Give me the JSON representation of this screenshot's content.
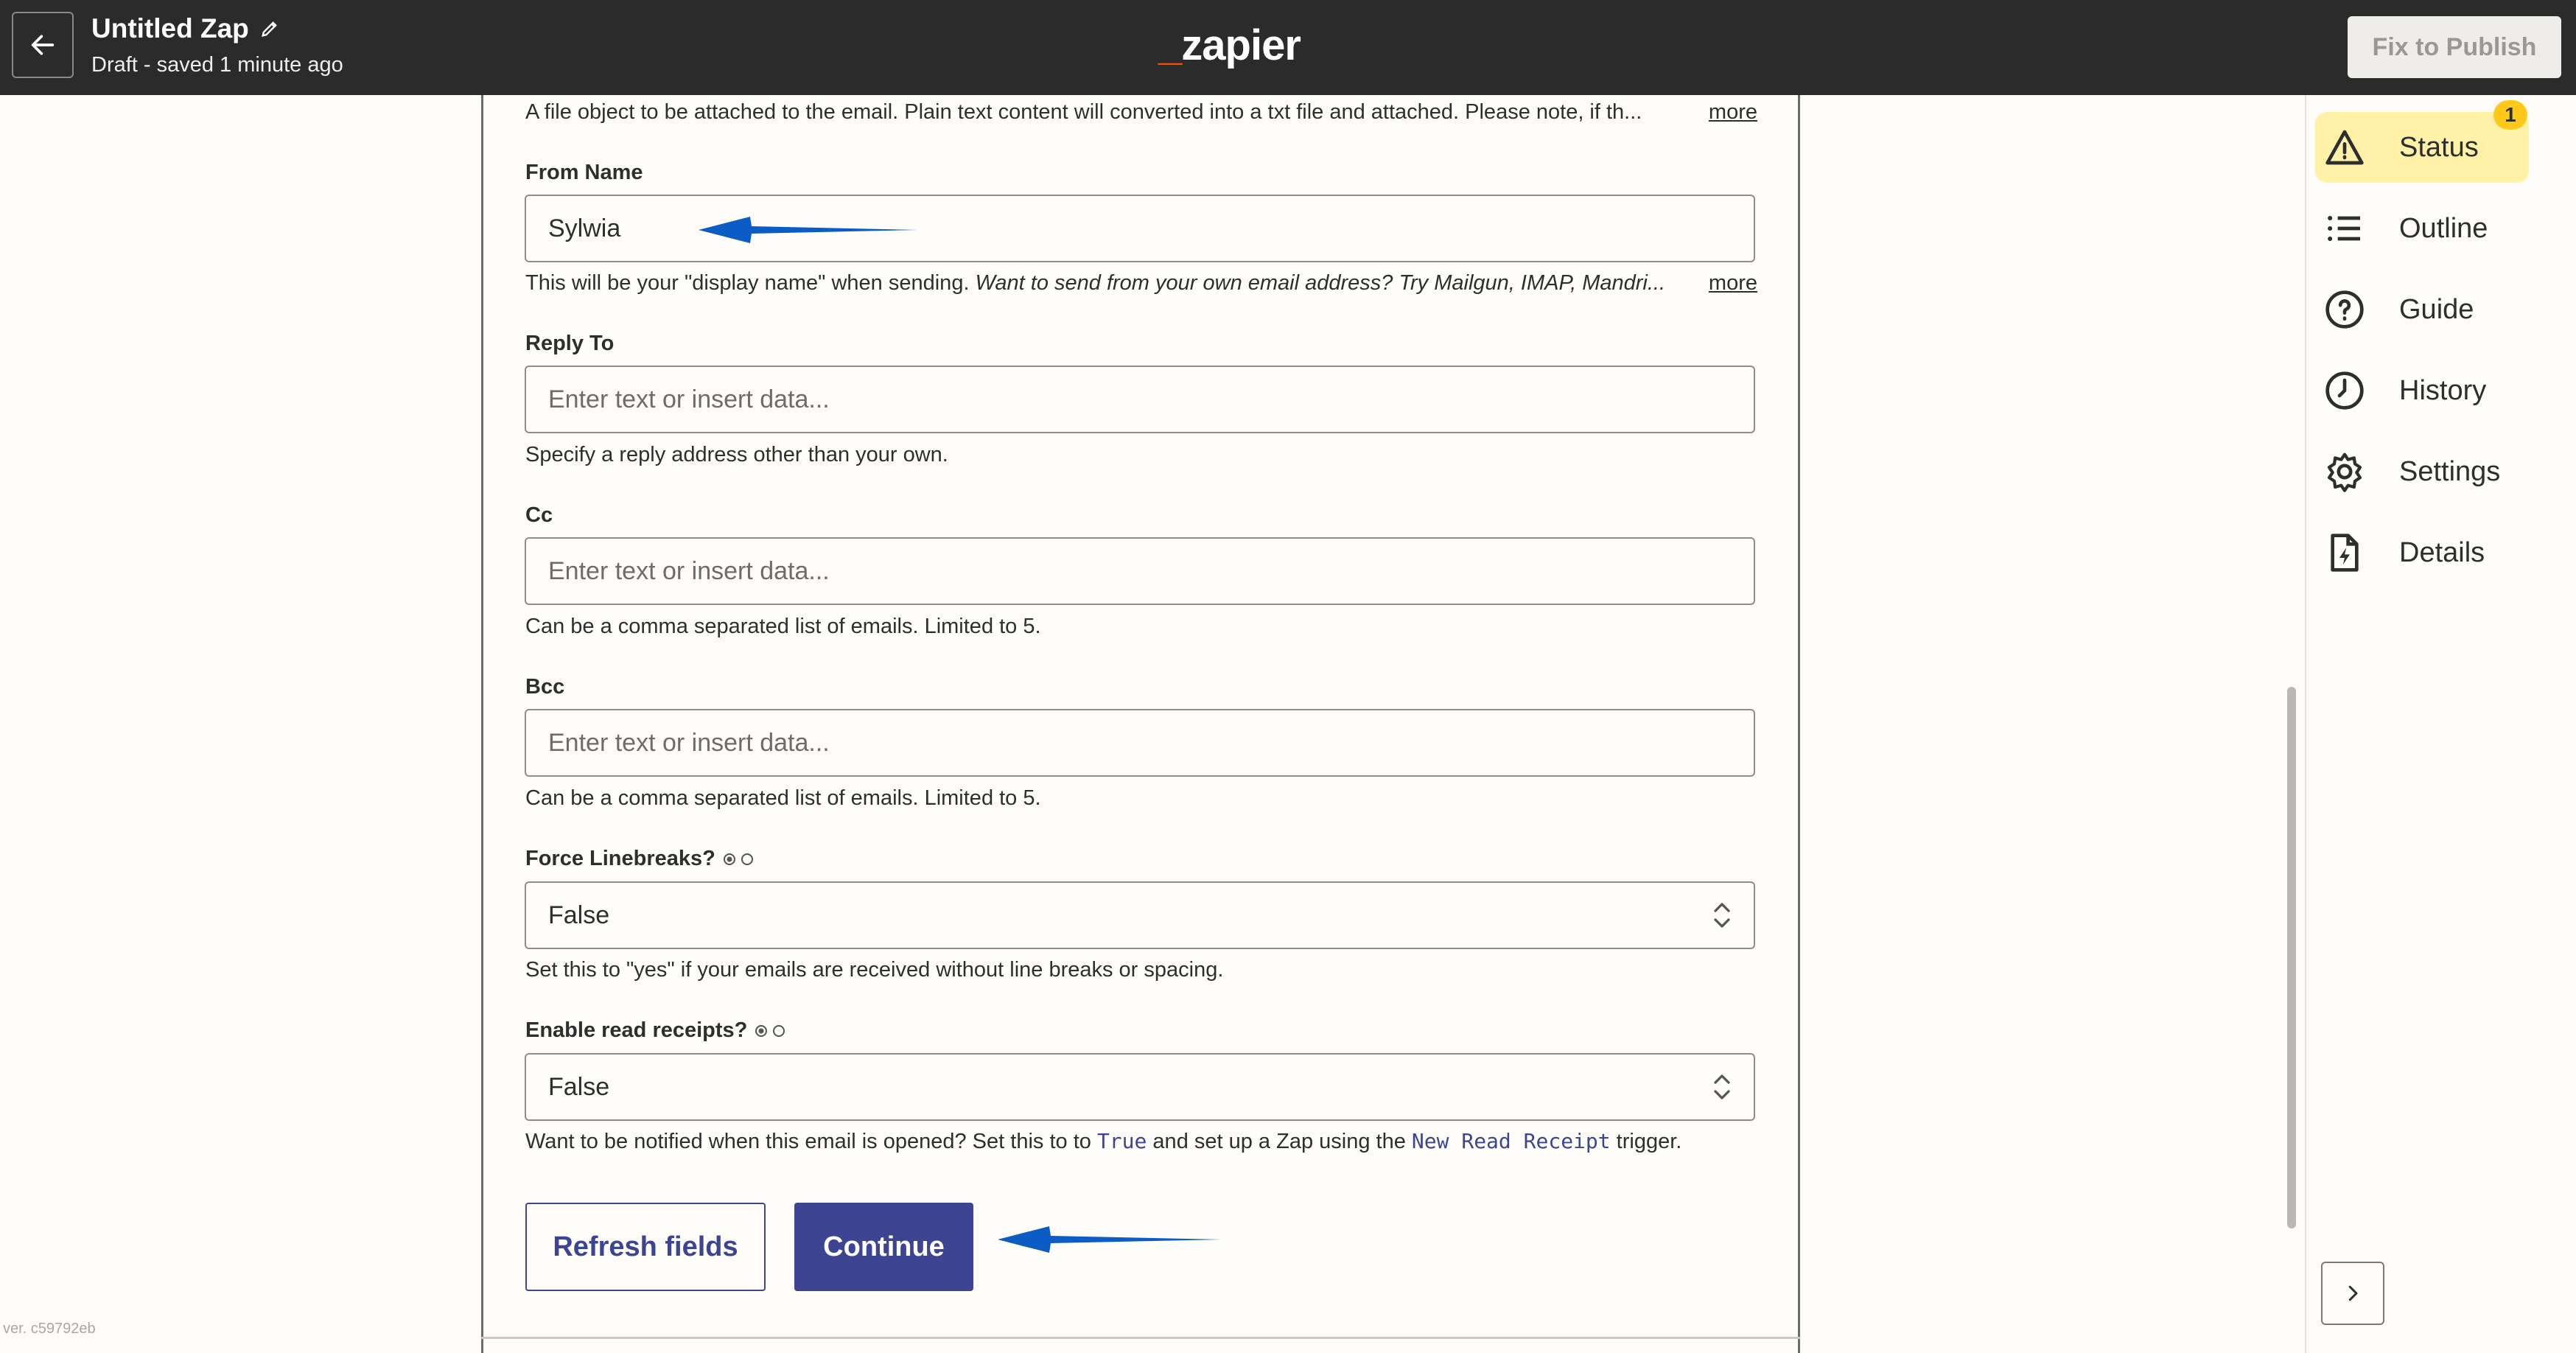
{
  "header": {
    "zap_title": "Untitled Zap",
    "status": "Draft - saved 1 minute ago",
    "logo_text": "zapier",
    "publish_label": "Fix to Publish"
  },
  "form": {
    "attachment_help": "A file object to be attached to the email. Plain text content will converted into a txt file and attached. Please note, if th...",
    "more_label": "more",
    "from_name": {
      "label": "From Name",
      "value": "Sylwia",
      "help_plain": "This will be your \"display name\" when sending. ",
      "help_italic": "Want to send from your own email address? Try Mailgun, IMAP, Mandri..."
    },
    "reply_to": {
      "label": "Reply To",
      "placeholder": "Enter text or insert data...",
      "help": "Specify a reply address other than your own."
    },
    "cc": {
      "label": "Cc",
      "placeholder": "Enter text or insert data...",
      "help": "Can be a comma separated list of emails. Limited to 5."
    },
    "bcc": {
      "label": "Bcc",
      "placeholder": "Enter text or insert data...",
      "help": "Can be a comma separated list of emails. Limited to 5."
    },
    "force_linebreaks": {
      "label": "Force Linebreaks?",
      "value": "False",
      "help": "Set this to \"yes\" if your emails are received without line breaks or spacing."
    },
    "read_receipts": {
      "label": "Enable read receipts?",
      "value": "False",
      "help_1": "Want to be notified when this email is opened? Set this to to ",
      "code_1": "True",
      "help_2": " and set up a Zap using the ",
      "code_2": "New Read Receipt",
      "help_3": " trigger."
    },
    "refresh_label": "Refresh fields",
    "continue_label": "Continue"
  },
  "sidebar": {
    "items": [
      {
        "label": "Status",
        "icon": "warning-icon",
        "badge": "1",
        "active": true
      },
      {
        "label": "Outline",
        "icon": "list-icon"
      },
      {
        "label": "Guide",
        "icon": "help-circle-icon"
      },
      {
        "label": "History",
        "icon": "clock-icon"
      },
      {
        "label": "Settings",
        "icon": "gear-icon"
      },
      {
        "label": "Details",
        "icon": "file-bolt-icon"
      }
    ]
  },
  "version": "ver. c59792eb",
  "colors": {
    "topbar": "#2b2b2b",
    "brand_orange": "#ff4a00",
    "primary": "#3d4592",
    "status_highlight": "#fff1a8",
    "badge": "#ffc91a",
    "annotation_arrow": "#0b5cc4"
  }
}
